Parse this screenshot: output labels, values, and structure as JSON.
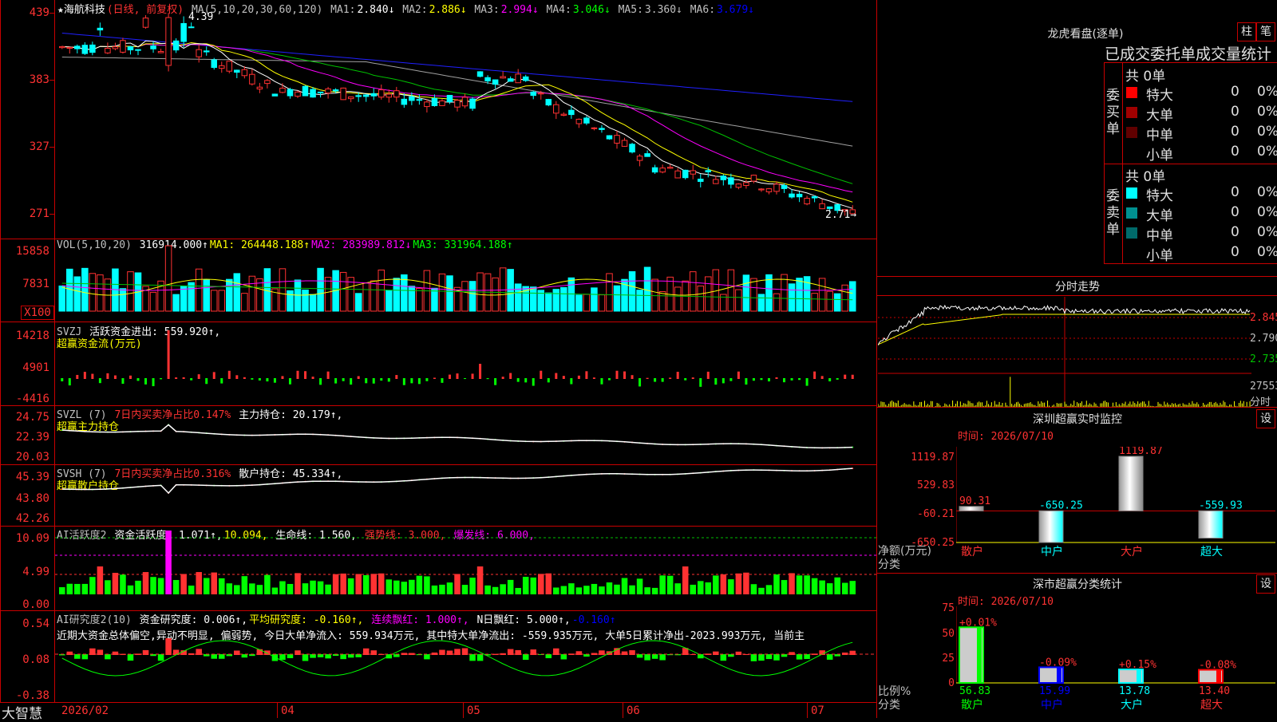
{
  "header": {
    "stock_name": "★海航科技",
    "period": "(日线, 前复权)",
    "ma_label": "MA(5,10,20,30,60,120)",
    "ma_values": [
      {
        "name": "MA1:",
        "value": "2.840↓",
        "color": "#ffffff"
      },
      {
        "name": "MA2:",
        "value": "2.886↓",
        "color": "#ffff00"
      },
      {
        "name": "MA3:",
        "value": "2.994↓",
        "color": "#ff00ff"
      },
      {
        "name": "MA4:",
        "value": "3.046↓",
        "color": "#00ff00"
      },
      {
        "name": "MA5:",
        "value": "3.360↓",
        "color": "#c0c0c0"
      },
      {
        "name": "MA6:",
        "value": "3.679↓",
        "color": "#0000ff"
      }
    ],
    "high_marker": "4.39",
    "low_marker": "2.71→"
  },
  "main_axis": [
    "439",
    "383",
    "327",
    "271"
  ],
  "vol_panel": {
    "title": "VOL(5,10,20)",
    "value": "316914.000↑",
    "ma1": "MA1: 264448.188↑",
    "ma2": "MA2: 283989.812↓",
    "ma3": "MA3: 331964.188↑",
    "axis": [
      "15858",
      "7831"
    ],
    "unit": "X100"
  },
  "svzj_panel": {
    "title": "SVZJ",
    "label": "活跃资金进出: 559.920↑,",
    "sub": "超赢资金流(万元)",
    "axis": [
      "14218",
      "4901",
      "-4416"
    ]
  },
  "svzl_panel": {
    "title": "SVZL (7)",
    "label1": "7日内买卖净占比0.147%",
    "label2": "主力持仓: 20.179↑,",
    "sub": "超赢主力持仓",
    "axis": [
      "24.75",
      "22.39",
      "20.03"
    ]
  },
  "svsh_panel": {
    "title": "SVSH (7)",
    "label1": "7日内买卖净占比0.316%",
    "label2": "散户持仓: 45.334↑,",
    "sub": "超赢散户持仓",
    "axis": [
      "45.39",
      "43.80",
      "42.26"
    ]
  },
  "ai_active_panel": {
    "title": "AI活跃度2",
    "label": "资金活跃度: 1.071↑,",
    "v2": "10.094,",
    "life": "生命线: 1.560,",
    "strong": "强势线: 3.000,",
    "burst": "爆发线: 6.000,",
    "axis": [
      "10.09",
      "4.99",
      "0.00"
    ]
  },
  "ai_research_panel": {
    "title": "AI研究度2(10)",
    "label": "资金研究度: 0.006↑,",
    "avg": "平均研究度: -0.160↑,",
    "cont": "连续飘红: 1.000↑,",
    "nday": "N日飘红: 5.000↑,",
    "last": "-0.160↑",
    "summary": "近期大资金总体偏空,异动不明显, 偏弱势, 今日大单净流入: 559.934万元, 其中特大单净流出: -559.935万元, 大单5日累计净出-2023.993万元, 当前主",
    "axis": [
      "0.54",
      "0.08",
      "-0.38"
    ]
  },
  "x_axis": {
    "logo": "大智慧",
    "labels": [
      "2026/02",
      "04",
      "05",
      "06",
      "07"
    ]
  },
  "right_top": {
    "title": "龙虎看盘(逐单)",
    "tabs": [
      "柱",
      "笔"
    ],
    "subtitle": "已成交委托单成交量统计",
    "buy": {
      "side_label": "委买单",
      "total": "共 0单",
      "rows": [
        {
          "name": "特大",
          "count": "0",
          "pct": "0%",
          "color": "#ff0000"
        },
        {
          "name": "大单",
          "count": "0",
          "pct": "0%",
          "color": "#a00000"
        },
        {
          "name": "中单",
          "count": "0",
          "pct": "0%",
          "color": "#600000"
        },
        {
          "name": "小单",
          "count": "0",
          "pct": "0%",
          "color": "#000000"
        }
      ]
    },
    "sell": {
      "side_label": "委卖单",
      "total": "共 0单",
      "rows": [
        {
          "name": "特大",
          "count": "0",
          "pct": "0%",
          "color": "#00ffff"
        },
        {
          "name": "大单",
          "count": "0",
          "pct": "0%",
          "color": "#009090"
        },
        {
          "name": "中单",
          "count": "0",
          "pct": "0%",
          "color": "#006a6a"
        },
        {
          "name": "小单",
          "count": "0",
          "pct": "0%",
          "color": "#000000"
        }
      ]
    }
  },
  "intraday": {
    "title": "分时走势",
    "axis": [
      "2.845",
      "2.790",
      "2.735",
      "27553"
    ],
    "vol_label": "分时"
  },
  "monitor": {
    "title": "深圳超赢实时监控",
    "btn": "设",
    "date": "时间: 2026/07/10",
    "axis": [
      "1119.87",
      "529.83",
      "-60.21",
      "-650.25"
    ],
    "ylabel": "净额(万元)",
    "xlabel": "分类",
    "bars": [
      {
        "cat": "散户",
        "value": 90.31,
        "label": "90.31"
      },
      {
        "cat": "中户",
        "value": -650.25,
        "label": "-650.25"
      },
      {
        "cat": "大户",
        "value": 1119.87,
        "label": "1119.87"
      },
      {
        "cat": "超大",
        "value": -559.93,
        "label": "-559.93"
      }
    ]
  },
  "classify": {
    "title": "深市超赢分类统计",
    "btn": "设",
    "date": "时间: 2026/07/10",
    "axis": [
      "75",
      "50",
      "25",
      "0"
    ],
    "ylabel": "比例%",
    "xlabel": "分类",
    "bars": [
      {
        "cat": "散户",
        "value": 56.83,
        "change": "+0.01%",
        "color": "#00ff00"
      },
      {
        "cat": "中户",
        "value": 15.99,
        "change": "-0.09%",
        "color": "#0000ff"
      },
      {
        "cat": "大户",
        "value": 13.78,
        "change": "+0.15%",
        "color": "#00ffff"
      },
      {
        "cat": "超大",
        "value": 13.4,
        "change": "-0.08%",
        "color": "#ff0000"
      }
    ]
  },
  "chart_data": [
    {
      "type": "bar",
      "title": "深圳超赢实时监控",
      "categories": [
        "散户",
        "中户",
        "大户",
        "超大"
      ],
      "values": [
        90.31,
        -650.25,
        1119.87,
        -559.93
      ],
      "ylabel": "净额(万元)",
      "xlabel": "分类",
      "ylim": [
        -650.25,
        1119.87
      ]
    },
    {
      "type": "bar",
      "title": "深市超赢分类统计",
      "categories": [
        "散户",
        "中户",
        "大户",
        "超大"
      ],
      "values": [
        56.83,
        15.99,
        13.78,
        13.4
      ],
      "ylabel": "比例%",
      "xlabel": "分类",
      "ylim": [
        0,
        75
      ]
    }
  ]
}
